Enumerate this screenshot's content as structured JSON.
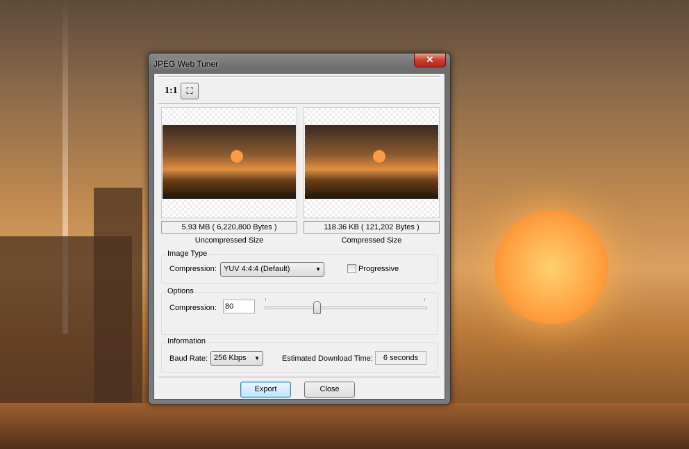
{
  "window": {
    "title": "JPEG Web Tuner",
    "close_icon": "close-icon"
  },
  "toolbar": {
    "actual_size_label": "1:1",
    "fit_icon": "fit-to-window-icon"
  },
  "preview": {
    "uncompressed": {
      "size": "5.93 MB ( 6,220,800 Bytes )",
      "caption": "Uncompressed Size"
    },
    "compressed": {
      "size": "118.36 KB ( 121,202 Bytes )",
      "caption": "Compressed Size"
    }
  },
  "image_type": {
    "group_label": "Image Type",
    "compression_label": "Compression:",
    "compression_value": "YUV 4:4:4 (Default)",
    "progressive_label": "Progressive",
    "progressive_checked": false
  },
  "options": {
    "group_label": "Options",
    "compression_label": "Compression:",
    "compression_value": "80",
    "slider_fraction": 0.32
  },
  "information": {
    "group_label": "Information",
    "baud_label": "Baud Rate:",
    "baud_value": "256 Kbps",
    "download_label": "Estimated Download Time:",
    "download_value": "6 seconds"
  },
  "buttons": {
    "export": "Export",
    "close": "Close"
  },
  "colors": {
    "sun": "#ffa040",
    "default_button": "#bee6fd"
  }
}
